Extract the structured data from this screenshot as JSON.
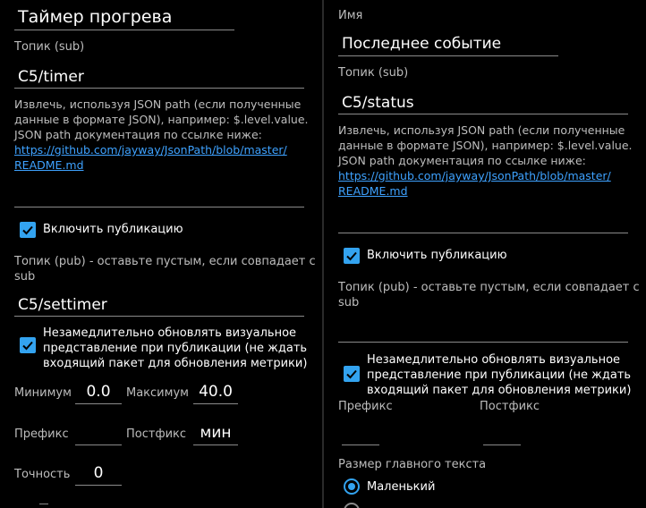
{
  "left": {
    "title_value": "Таймер прогрева",
    "topic_sub_label": "Топик (sub)",
    "topic_sub_value": "C5/timer",
    "json_hint_line1": "Извлечь, используя JSON path (если полученные",
    "json_hint_line2": "данные в формате JSON), например: $.level.value.",
    "json_hint_line3": "JSON path документация по ссылке ниже:",
    "link_line1": "https://github.com/jayway/JsonPath/blob/master/",
    "link_line2": "README.md",
    "json_path_value": "",
    "publish_checkbox_label": "Включить публикацию",
    "publish_checked": true,
    "topic_pub_hint_line1": "Топик (pub) - оставьте пустым, если совпадает с",
    "topic_pub_hint_line2": "sub",
    "topic_pub_value": "C5/settimer",
    "instant_update_line1": "Незамедлительно обновлять визуальное",
    "instant_update_line2": "представление при публикации (не ждать",
    "instant_update_line3": "входящий пакет для обновления метрики)",
    "instant_update_checked": true,
    "min_label": "Минимум",
    "min_value": "0.0",
    "max_label": "Максимум",
    "max_value": "40.0",
    "prefix_label": "Префикс",
    "prefix_value": "",
    "postfix_label": "Постфикс",
    "postfix_value": "мин",
    "precision_label": "Точность",
    "precision_value": "0"
  },
  "right": {
    "name_label": "Имя",
    "name_value": "Последнее событие",
    "topic_sub_label": "Топик (sub)",
    "topic_sub_value": "C5/status",
    "json_hint_line1": "Извлечь, используя JSON path (если полученные",
    "json_hint_line2": "данные в формате JSON), например: $.level.value.",
    "json_hint_line3": "JSON path документация по ссылке ниже:",
    "link_line1": "https://github.com/jayway/JsonPath/blob/master/",
    "link_line2": "README.md",
    "json_path_value": "",
    "publish_checkbox_label": "Включить публикацию",
    "publish_checked": true,
    "topic_pub_hint_line1": "Топик (pub) - оставьте пустым, если совпадает с",
    "topic_pub_hint_line2": "sub",
    "topic_pub_value": "",
    "instant_update_line1": "Незамедлительно обновлять визуальное",
    "instant_update_line2": "представление при публикации (не ждать",
    "instant_update_line3": "входящий пакет для обновления метрики)",
    "instant_update_checked": true,
    "prefix_label": "Префикс",
    "prefix_value": "",
    "postfix_label": "Постфикс",
    "postfix_value": "",
    "main_text_size_label": "Размер главного текста",
    "size_option_small": "Маленький",
    "size_option_small_selected": true
  },
  "colors": {
    "background": "#000000",
    "accent": "#33a3f0",
    "link": "#3ea2ff",
    "hint_text": "#bdbdbd",
    "underline": "#8a8a8a"
  }
}
